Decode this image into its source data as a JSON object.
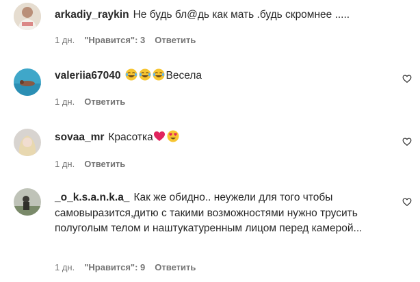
{
  "comments": [
    {
      "username": "arkadiy_raykin",
      "text": "Не будь бл@дь как мать .будь скромнее .....",
      "time": "1 дн.",
      "likes": "\"Нравится\": 3",
      "reply": "Ответить"
    },
    {
      "username": "valeriia67040",
      "text": "Весела",
      "emojis": [
        "laughing-tears",
        "laughing-tears",
        "laughing-tears"
      ],
      "time": "1 дн.",
      "reply": "Ответить"
    },
    {
      "username": "sovaa_mr",
      "text": "Красотка",
      "emojis": [
        "red-heart",
        "heart-eyes"
      ],
      "time": "1 дн.",
      "reply": "Ответить"
    },
    {
      "username": "_o_k.s.a.n.k.a_",
      "text": "Как же обидно.. неужели для того чтобы самовыразится,дитю с такими возможностями нужно трусить полуголым телом и наштукатуренным лицом перед камерой...",
      "time": "1 дн.",
      "likes": "\"Нравится\": 9",
      "reply": "Ответить"
    }
  ],
  "colors": {
    "text": "#262626",
    "muted": "#737373"
  }
}
